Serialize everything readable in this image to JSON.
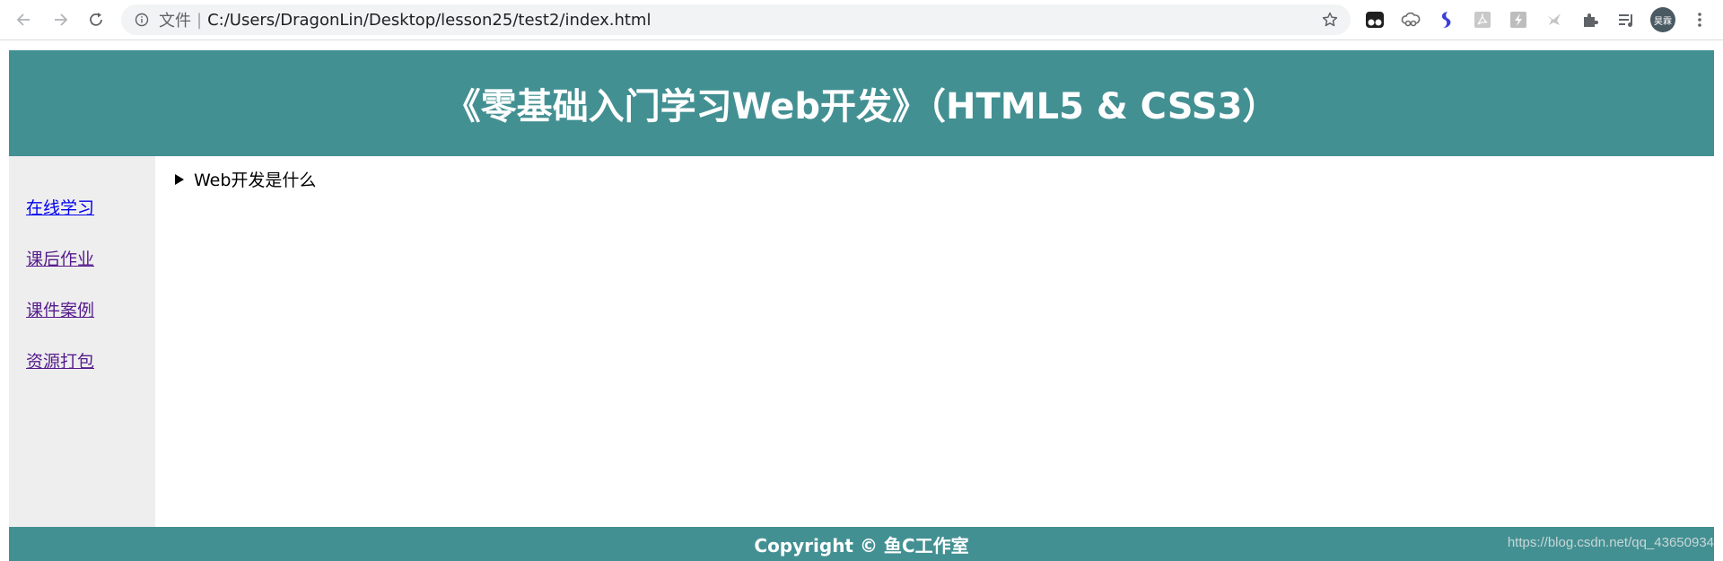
{
  "browser": {
    "scheme_label": "文件",
    "separator": "|",
    "url": "C:/Users/DragonLin/Desktop/lesson25/test2/index.html",
    "avatar_text": "昊霖",
    "icons": {
      "back": "arrow-left-icon",
      "forward": "arrow-right-icon",
      "reload": "reload-icon",
      "info": "info-icon",
      "bookmark": "star-icon",
      "extensions": [
        "tampermonkey-icon",
        "cloud-link-icon",
        "blue-s-icon",
        "pdf-icon",
        "bolt-icon",
        "bird-icon",
        "puzzle-icon",
        "reading-list-icon"
      ],
      "menu": "more-vert-icon"
    }
  },
  "page": {
    "header_title": "《零基础入门学习Web开发》（HTML5 & CSS3）",
    "nav": [
      {
        "label": "在线学习",
        "visited": false
      },
      {
        "label": "课后作业",
        "visited": true
      },
      {
        "label": "课件案例",
        "visited": true
      },
      {
        "label": "资源打包",
        "visited": true
      }
    ],
    "details_summary": "Web开发是什么",
    "footer": "Copyright © 鱼C工作室",
    "watermark": "https://blog.csdn.net/qq_43650934"
  },
  "colors": {
    "accent": "#439093",
    "sidebar_bg": "#eeeeee",
    "link": "#0000ee",
    "visited_link": "#551a8b"
  }
}
